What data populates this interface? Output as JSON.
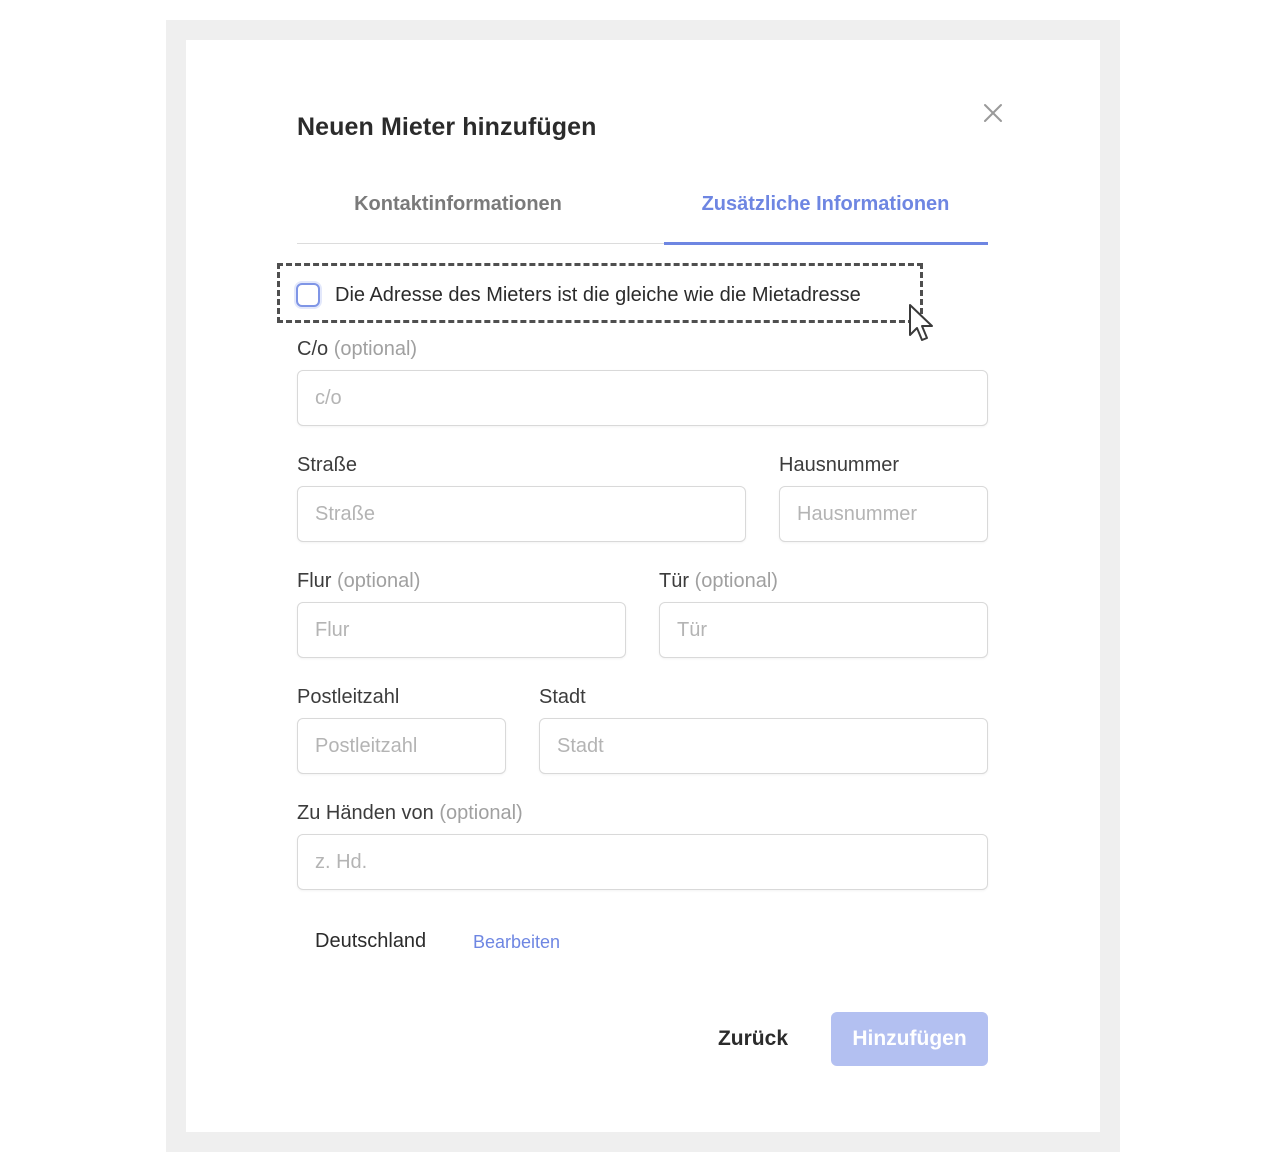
{
  "dialog": {
    "title": "Neuen Mieter hinzufügen",
    "close_icon": "close-icon"
  },
  "tabs": [
    {
      "label": "Kontaktinformationen",
      "active": false
    },
    {
      "label": "Zusätzliche Informationen",
      "active": true
    }
  ],
  "same_address": {
    "label": "Die Adresse des Mieters ist die gleiche wie die Mietadresse",
    "checked": false
  },
  "fields": {
    "co": {
      "label": "C/o",
      "optional": "(optional)",
      "placeholder": "c/o",
      "value": ""
    },
    "street": {
      "label": "Straße",
      "placeholder": "Straße",
      "value": ""
    },
    "house_number": {
      "label": "Hausnummer",
      "placeholder": "Hausnummer",
      "value": ""
    },
    "floor": {
      "label": "Flur",
      "optional": "(optional)",
      "placeholder": "Flur",
      "value": ""
    },
    "door": {
      "label": "Tür",
      "optional": "(optional)",
      "placeholder": "Tür",
      "value": ""
    },
    "postal_code": {
      "label": "Postleitzahl",
      "placeholder": "Postleitzahl",
      "value": ""
    },
    "city": {
      "label": "Stadt",
      "placeholder": "Stadt",
      "value": ""
    },
    "attention": {
      "label": "Zu Händen von",
      "optional": "(optional)",
      "placeholder": "z. Hd.",
      "value": ""
    }
  },
  "country": {
    "value": "Deutschland",
    "edit_label": "Bearbeiten"
  },
  "actions": {
    "back_label": "Zurück",
    "submit_label": "Hinzufügen"
  },
  "colors": {
    "accent": "#6e86e2",
    "submit_disabled": "#b3c0f1",
    "backdrop": "#efefef"
  }
}
